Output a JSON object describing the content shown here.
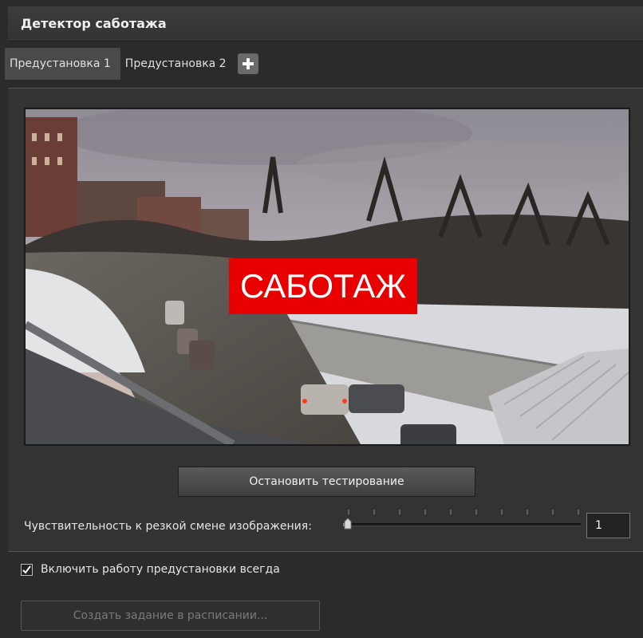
{
  "window": {
    "title": "Детектор саботажа"
  },
  "tabs": [
    {
      "label": "Предустановка 1",
      "active": true
    },
    {
      "label": "Предустановка 2",
      "active": false
    }
  ],
  "tab_add_icon": "plus-icon",
  "video": {
    "overlay_text": "САБОТАЖ",
    "overlay_color": "#e80000",
    "description_icon": "camera-view"
  },
  "controls": {
    "stop_button_label": "Остановить тестирование",
    "sensitivity_label": "Чувствительность к резкой смене изображения:",
    "sensitivity_value": "1",
    "sensitivity_min": 1,
    "sensitivity_max": 10,
    "sensitivity_fraction": 0.0
  },
  "options": {
    "always_enabled_label": "Включить работу предустановки всегда",
    "always_enabled_checked": true,
    "schedule_button_label": "Создать задание в расписании...",
    "schedule_button_enabled": false
  }
}
